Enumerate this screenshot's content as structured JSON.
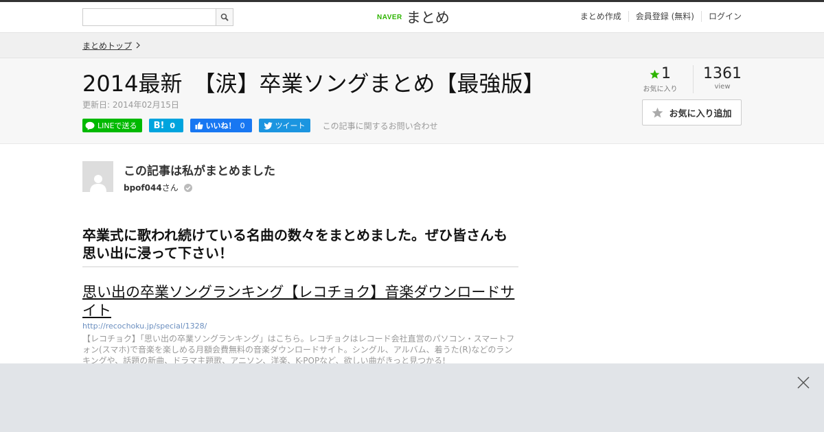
{
  "header": {
    "search": {
      "placeholder": "",
      "value": ""
    },
    "logo": {
      "brand": "NAVER",
      "name": "まとめ"
    },
    "nav": [
      {
        "label": "まとめ作成"
      },
      {
        "label": "会員登録 (無料)"
      },
      {
        "label": "ログイン"
      }
    ]
  },
  "breadcrumb": {
    "label": "まとめトップ"
  },
  "article": {
    "title": "2014最新　【涙】卒業ソングまとめ【最強版】",
    "updated": "更新日: 2014年02月15日",
    "share": {
      "line": "LINEで送る",
      "hatena_mark": "B!",
      "hatena_count": "0",
      "facebook": "いいね！",
      "facebook_count": "0",
      "tweet": "ツイート",
      "contact": "この記事に関するお問い合わせ"
    },
    "stats": {
      "favorites": "1",
      "favorites_label": "お気に入り",
      "views": "1361",
      "views_label": "view"
    },
    "fav_button": "お気に入り追加"
  },
  "author": {
    "heading": "この記事は私がまとめました",
    "name": "bpof044",
    "suffix": "さん"
  },
  "content": {
    "lead": "卒業式に歌われ続けている名曲の数々をまとめました。ぜひ皆さんも思い出に浸って下さい！",
    "link": {
      "title": "思い出の卒業ソングランキング【レコチョク】音楽ダウンロードサイト",
      "url": "http://recochoku.jp/special/1328/",
      "description": "【レコチョク】「思い出の卒業ソングランキング」はこちら。レコチョクはレコード会社直営のパソコン・スマートフォン(スマホ)で音楽を楽しめる月額会費無料の音楽ダウンロードサイト。シングル、アルバム、着うた(R)などのランキングや、話題の新曲、ドラマ主題歌、アニソン、洋楽、K-POPなど、欲しい曲がきっと見つかる!"
    }
  },
  "colors": {
    "naver_green": "#2db400",
    "line_green": "#00b900",
    "hatena_blue": "#00a4de",
    "facebook_blue": "#1877f2",
    "twitter_blue": "#1b95e0",
    "ad_bar": "#e1e4e8"
  }
}
